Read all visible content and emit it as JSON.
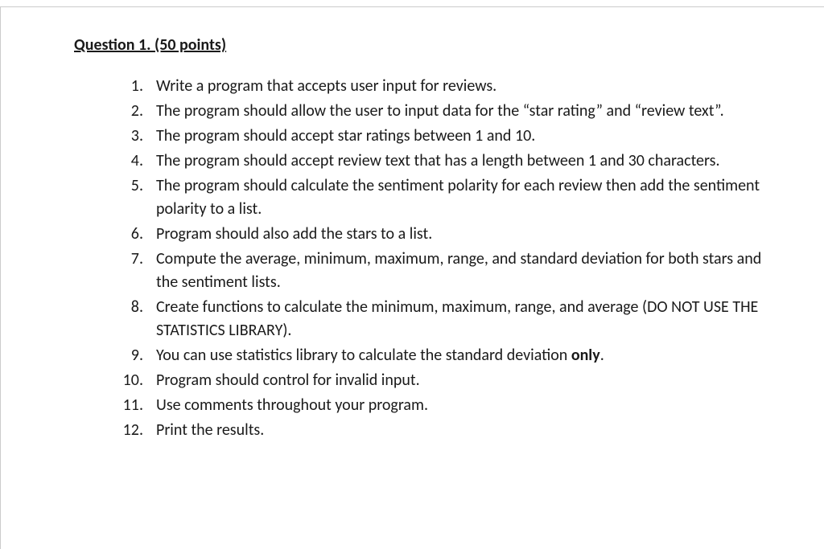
{
  "title": "Question 1. (50 points)",
  "items": [
    {
      "num": "1",
      "text": "Write a program that accepts user input for reviews."
    },
    {
      "num": "2",
      "text": "The program should allow the user to input data for the “star rating” and “review text”."
    },
    {
      "num": "3",
      "text": "The program should accept star ratings between 1 and 10."
    },
    {
      "num": "4",
      "text": "The program should accept review text that has a length between 1 and 30 characters."
    },
    {
      "num": "5",
      "text": "The program should calculate the sentiment polarity for each review then add the sentiment polarity to a list."
    },
    {
      "num": "6",
      "text": "Program should also add the stars to a list."
    },
    {
      "num": "7",
      "text": "Compute the average, minimum, maximum, range, and standard deviation for both stars and the sentiment lists."
    },
    {
      "num": "8",
      "text": "Create functions to calculate the minimum, maximum, range, and average (DO NOT USE THE STATISTICS LIBRARY)."
    },
    {
      "num": "9",
      "pre": "You can use statistics library to calculate the standard deviation ",
      "bold": "only",
      "post": "."
    },
    {
      "num": "10",
      "text": "Program should control for invalid input."
    },
    {
      "num": "11",
      "text": "Use comments throughout your program."
    },
    {
      "num": "12",
      "text": "Print the results."
    }
  ]
}
